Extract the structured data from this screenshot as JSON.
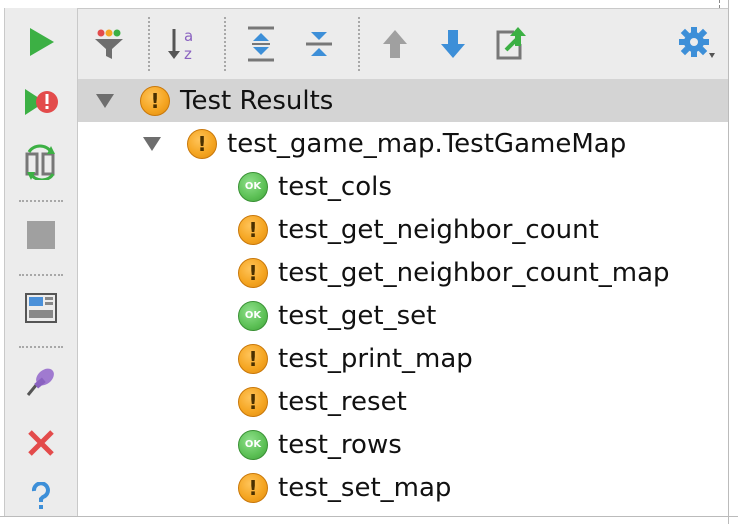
{
  "toolbar_left": {
    "buttons": [
      {
        "name": "run-icon"
      },
      {
        "name": "rerun-failed-icon"
      },
      {
        "name": "toggle-auto-test-icon"
      },
      {
        "name": "stop-icon"
      },
      {
        "name": "layout-icon"
      },
      {
        "name": "pin-icon"
      },
      {
        "name": "close-icon"
      },
      {
        "name": "help-icon"
      }
    ]
  },
  "toolbar_top": {
    "buttons": [
      {
        "name": "filter-icon"
      },
      {
        "name": "sort-alphabetically-icon",
        "text": "a z"
      },
      {
        "name": "expand-all-icon"
      },
      {
        "name": "collapse-all-icon"
      },
      {
        "name": "previous-icon"
      },
      {
        "name": "next-icon"
      },
      {
        "name": "export-icon"
      },
      {
        "name": "settings-icon"
      }
    ]
  },
  "colors": {
    "run_green": "#3cb044",
    "warn_orange": "#f5a623",
    "ok_green": "#5cc055",
    "arrow_blue": "#3d8fd8",
    "close_red": "#e34b4b",
    "help_blue": "#3d8fd8"
  },
  "tree": {
    "root": {
      "label": "Test Results",
      "status": "warning"
    },
    "suite": {
      "label": "test_game_map.TestGameMap",
      "status": "warning"
    },
    "ok_badge": "OK",
    "warn_badge": "!",
    "tests": [
      {
        "label": "test_cols",
        "status": "ok"
      },
      {
        "label": "test_get_neighbor_count",
        "status": "warning"
      },
      {
        "label": "test_get_neighbor_count_map",
        "status": "warning"
      },
      {
        "label": "test_get_set",
        "status": "ok"
      },
      {
        "label": "test_print_map",
        "status": "warning"
      },
      {
        "label": "test_reset",
        "status": "warning"
      },
      {
        "label": "test_rows",
        "status": "ok"
      },
      {
        "label": "test_set_map",
        "status": "warning"
      }
    ]
  }
}
